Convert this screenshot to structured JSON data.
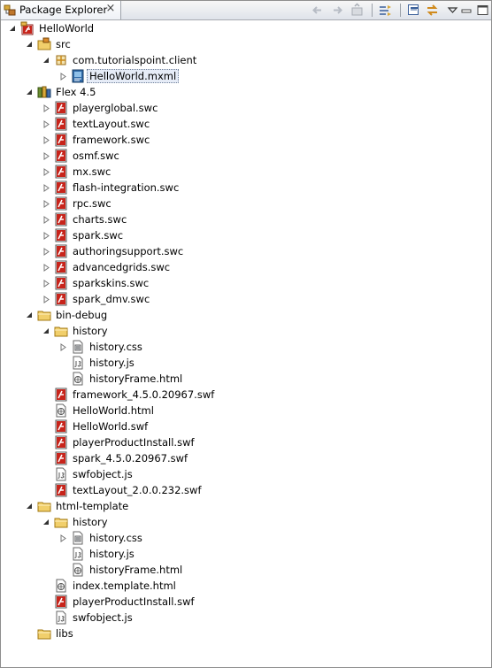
{
  "panel": {
    "title": "Package Explorer",
    "close_glyph": "×",
    "toolbar": [
      "back-icon",
      "forward-icon",
      "up-icon",
      "link-with-editor-icon",
      "collapse-all-icon",
      "sync-icon",
      "view-menu-icon",
      "minimize-icon",
      "maximize-icon"
    ]
  },
  "tree": [
    {
      "label": "HelloWorld",
      "icon": "flex-project-icon",
      "depth": 0,
      "twisty": "expanded"
    },
    {
      "label": "src",
      "icon": "source-folder-icon",
      "depth": 1,
      "twisty": "expanded"
    },
    {
      "label": "com.tutorialspoint.client",
      "icon": "package-icon",
      "depth": 2,
      "twisty": "expanded"
    },
    {
      "label": "HelloWorld.mxml",
      "icon": "mxml-file-icon",
      "depth": 3,
      "twisty": "collapsed",
      "selected": true
    },
    {
      "label": "Flex 4.5",
      "icon": "library-icon",
      "depth": 1,
      "twisty": "expanded"
    },
    {
      "label": "playerglobal.swc",
      "icon": "swc-icon",
      "depth": 2,
      "twisty": "collapsed"
    },
    {
      "label": "textLayout.swc",
      "icon": "swc-icon",
      "depth": 2,
      "twisty": "collapsed"
    },
    {
      "label": "framework.swc",
      "icon": "swc-icon",
      "depth": 2,
      "twisty": "collapsed"
    },
    {
      "label": "osmf.swc",
      "icon": "swc-icon",
      "depth": 2,
      "twisty": "collapsed"
    },
    {
      "label": "mx.swc",
      "icon": "swc-icon",
      "depth": 2,
      "twisty": "collapsed"
    },
    {
      "label": "flash-integration.swc",
      "icon": "swc-icon",
      "depth": 2,
      "twisty": "collapsed"
    },
    {
      "label": "rpc.swc",
      "icon": "swc-icon",
      "depth": 2,
      "twisty": "collapsed"
    },
    {
      "label": "charts.swc",
      "icon": "swc-icon",
      "depth": 2,
      "twisty": "collapsed"
    },
    {
      "label": "spark.swc",
      "icon": "swc-icon",
      "depth": 2,
      "twisty": "collapsed"
    },
    {
      "label": "authoringsupport.swc",
      "icon": "swc-icon",
      "depth": 2,
      "twisty": "collapsed"
    },
    {
      "label": "advancedgrids.swc",
      "icon": "swc-icon",
      "depth": 2,
      "twisty": "collapsed"
    },
    {
      "label": "sparkskins.swc",
      "icon": "swc-icon",
      "depth": 2,
      "twisty": "collapsed"
    },
    {
      "label": "spark_dmv.swc",
      "icon": "swc-icon",
      "depth": 2,
      "twisty": "collapsed"
    },
    {
      "label": "bin-debug",
      "icon": "folder-icon",
      "depth": 1,
      "twisty": "expanded"
    },
    {
      "label": "history",
      "icon": "folder-icon",
      "depth": 2,
      "twisty": "expanded"
    },
    {
      "label": "history.css",
      "icon": "css-file-icon",
      "depth": 3,
      "twisty": "collapsed"
    },
    {
      "label": "history.js",
      "icon": "js-file-icon",
      "depth": 3,
      "twisty": "none"
    },
    {
      "label": "historyFrame.html",
      "icon": "html-file-icon",
      "depth": 3,
      "twisty": "none"
    },
    {
      "label": "framework_4.5.0.20967.swf",
      "icon": "swf-icon",
      "depth": 2,
      "twisty": "none"
    },
    {
      "label": "HelloWorld.html",
      "icon": "html-file-icon",
      "depth": 2,
      "twisty": "none"
    },
    {
      "label": "HelloWorld.swf",
      "icon": "swf-icon",
      "depth": 2,
      "twisty": "none"
    },
    {
      "label": "playerProductInstall.swf",
      "icon": "swf-icon",
      "depth": 2,
      "twisty": "none"
    },
    {
      "label": "spark_4.5.0.20967.swf",
      "icon": "swf-icon",
      "depth": 2,
      "twisty": "none"
    },
    {
      "label": "swfobject.js",
      "icon": "js-file-icon",
      "depth": 2,
      "twisty": "none"
    },
    {
      "label": "textLayout_2.0.0.232.swf",
      "icon": "swf-icon",
      "depth": 2,
      "twisty": "none"
    },
    {
      "label": "html-template",
      "icon": "folder-icon",
      "depth": 1,
      "twisty": "expanded"
    },
    {
      "label": "history",
      "icon": "folder-icon",
      "depth": 2,
      "twisty": "expanded"
    },
    {
      "label": "history.css",
      "icon": "css-file-icon",
      "depth": 3,
      "twisty": "collapsed"
    },
    {
      "label": "history.js",
      "icon": "js-file-icon",
      "depth": 3,
      "twisty": "none"
    },
    {
      "label": "historyFrame.html",
      "icon": "html-file-icon",
      "depth": 3,
      "twisty": "none"
    },
    {
      "label": "index.template.html",
      "icon": "html-file-icon",
      "depth": 2,
      "twisty": "none"
    },
    {
      "label": "playerProductInstall.swf",
      "icon": "swf-icon",
      "depth": 2,
      "twisty": "none"
    },
    {
      "label": "swfobject.js",
      "icon": "js-file-icon",
      "depth": 2,
      "twisty": "none"
    },
    {
      "label": "libs",
      "icon": "folder-icon",
      "depth": 1,
      "twisty": "none"
    }
  ]
}
